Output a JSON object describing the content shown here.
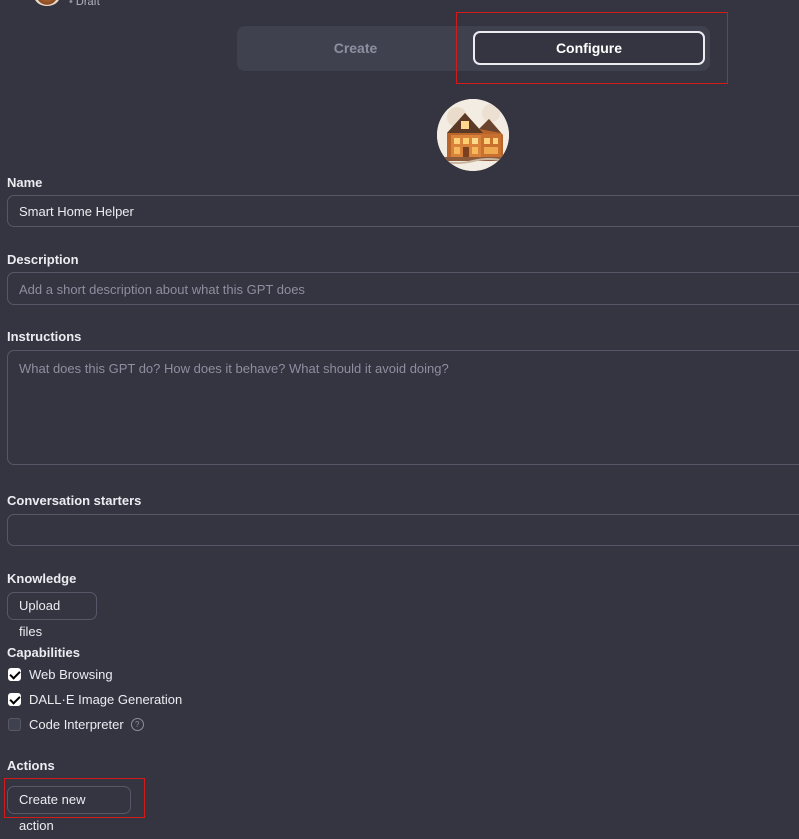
{
  "header": {
    "status": "Draft",
    "status_dot": "•"
  },
  "tabs": {
    "create_label": "Create",
    "configure_label": "Configure",
    "active": "Configure"
  },
  "form": {
    "avatar_icon": "house-illustration-avatar",
    "name_label": "Name",
    "name_value": "Smart Home Helper",
    "description_label": "Description",
    "description_placeholder": "Add a short description about what this GPT does",
    "instructions_label": "Instructions",
    "instructions_placeholder": "What does this GPT do? How does it behave? What should it avoid doing?",
    "starters_label": "Conversation starters",
    "starters_value": "",
    "knowledge_label": "Knowledge",
    "upload_label": "Upload files",
    "capabilities_label": "Capabilities",
    "capabilities": [
      {
        "label": "Web Browsing",
        "checked": true
      },
      {
        "label": "DALL·E Image Generation",
        "checked": true
      },
      {
        "label": "Code Interpreter",
        "checked": false
      }
    ],
    "help_glyph": "?",
    "actions_label": "Actions",
    "create_action_label": "Create new action"
  },
  "colors": {
    "background": "#343541",
    "panel": "#40414f",
    "border": "#565869",
    "text": "#ececf1",
    "muted": "#8e8ea0",
    "highlight": "#d11a1a"
  }
}
